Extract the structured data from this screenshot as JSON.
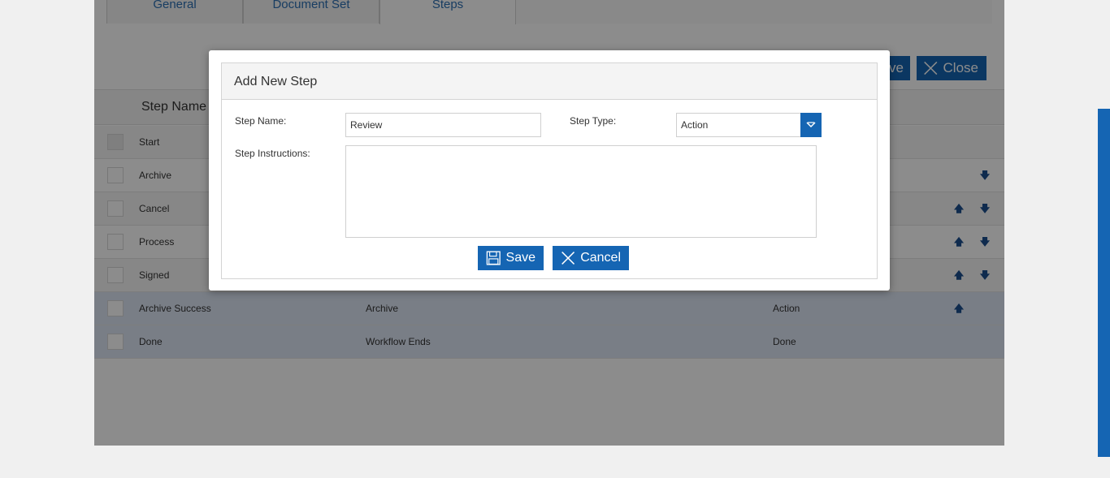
{
  "tabs": [
    "General",
    "Document Set",
    "Steps"
  ],
  "toolbar": {
    "save_label": "ve",
    "close_label": "Close"
  },
  "grid": {
    "header_name": "Step Name",
    "rows": [
      {
        "name": "Start",
        "col2": "",
        "col3": ""
      },
      {
        "name": "Archive",
        "col2": "",
        "col3": ""
      },
      {
        "name": "Cancel",
        "col2": "",
        "col3": ""
      },
      {
        "name": "Process",
        "col2": "",
        "col3": ""
      },
      {
        "name": "Signed",
        "col2": "",
        "col3": ""
      },
      {
        "name": "Archive Success",
        "col2": "Archive",
        "col3": "Action"
      },
      {
        "name": "Done",
        "col2": "Workflow Ends",
        "col3": "Done"
      }
    ]
  },
  "dialog": {
    "title": "Add New Step",
    "step_name_label": "Step Name:",
    "step_name_value": "Review",
    "step_type_label": "Step Type:",
    "step_type_value": "Action",
    "instructions_label": "Step Instructions:",
    "instructions_value": "",
    "save_label": "Save",
    "cancel_label": "Cancel"
  },
  "colors": {
    "accent": "#1565b3",
    "overlay": "#000000"
  }
}
